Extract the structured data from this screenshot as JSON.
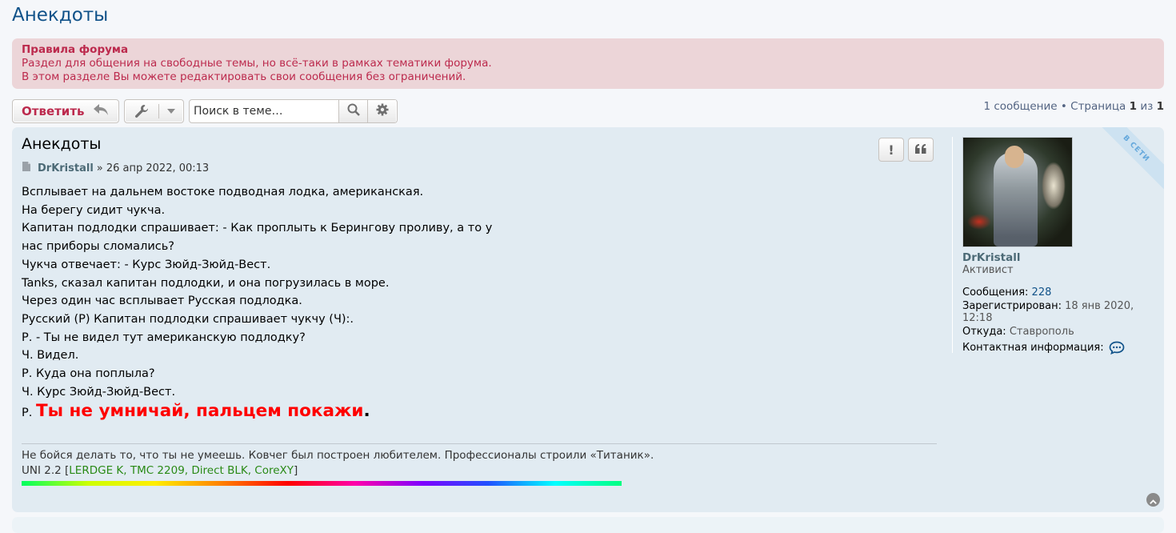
{
  "page": {
    "title": "Анекдоты"
  },
  "rules": {
    "title": "Правила форума",
    "line1": "Раздел для общения на свободные темы, но всё-таки в рамках тематики форума.",
    "line2": "В этом разделе Вы можете редактировать свои сообщения без ограничений."
  },
  "toolbar": {
    "reply_label": "Ответить",
    "search_placeholder": "Поиск в теме…"
  },
  "pagination": {
    "count_text": "1 сообщение",
    "separator": "•",
    "page_word": "Страница",
    "current": "1",
    "of_word": "из",
    "total": "1"
  },
  "post": {
    "title": "Анекдоты",
    "author": "DrKristall",
    "date": "» 26 апр 2022, 00:13",
    "lines": [
      "Всплывает на дальнем востоке подводная лодка, американская.",
      "На берегу сидит чукча.",
      "Капитан подлодки спрашивает: - Как проплыть к Берингову проливу, а то у",
      "нас приборы сломались?",
      "Чукча отвечает: - Курс Зюйд-Зюйд-Вест.",
      "Tanks, сказал капитан подлодки, и она погрузилась в море.",
      "Через один час всплывает Русская подлодка.",
      "Русский (Р) Капитан подлодки спрашивает чукчу (Ч):.",
      "Р. - Ты не видел тут американскую подлодку?",
      "Ч. Видел.",
      "Р. Куда она поплыла?",
      "Ч. Курс Зюйд-Зюйд-Вест."
    ],
    "last_prefix": "Р.",
    "last_big": "Ты не умничай, пальцем покажи",
    "last_suffix": ".",
    "signature_quote": "Не бойся делать то, что ты не умеешь. Ковчег был построен любителем. Профессионалы строили «Титаник».",
    "signature_prefix": "UNI 2.2 [",
    "signature_green": "LERDGE K, TMC 2209, Direct BLK, CoreXY",
    "signature_suffix": "]"
  },
  "profile": {
    "username": "DrKristall",
    "rank": "Активист",
    "online_badge": "В СЕТИ",
    "posts_label": "Сообщения:",
    "posts_value": "228",
    "registered_label": "Зарегистрирован:",
    "registered_value": "18 янв 2020, 12:18",
    "from_label": "Откуда:",
    "from_value": "Ставрополь",
    "contact_label": "Контактная информация:"
  },
  "colors": {
    "link": "#105289",
    "rules_text": "#bc2a4d",
    "post_bg": "#e1ebf2",
    "highlight_red": "#ff0000",
    "signature_green": "#2a8a16"
  }
}
